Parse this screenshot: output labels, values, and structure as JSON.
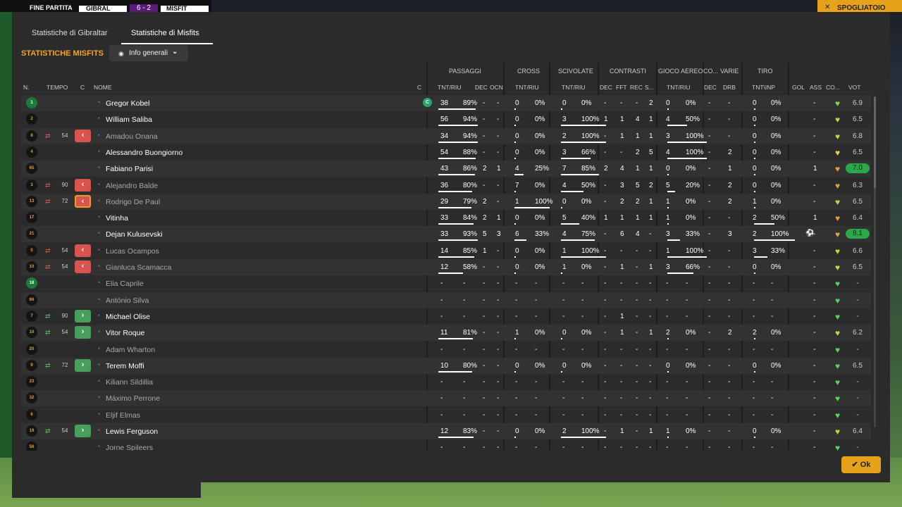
{
  "topbar": {
    "fine_partita": "FINE PARTITA",
    "team1": "GIBRAL",
    "score": "6 - 2",
    "team2": "MISFIT",
    "right_label": "SPOGLIATOIO",
    "close": "✕"
  },
  "tabs": [
    {
      "label": "Statistiche di Gibraltar"
    },
    {
      "label": "Statistiche di Misfits"
    }
  ],
  "section_title": "STATISTICHE MISFITS",
  "dropdown": {
    "label": "Info generali"
  },
  "groups": [
    {
      "label": "PASSAGGI"
    },
    {
      "label": "CROSS"
    },
    {
      "label": "SCIVOLATE"
    },
    {
      "label": "CONTRASTI"
    },
    {
      "label": "GIOCO AEREO"
    },
    {
      "label": "CO..."
    },
    {
      "label": "VARIE"
    },
    {
      "label": "TIRO"
    }
  ],
  "columns": {
    "n": "N.",
    "tempo": "TEMPO",
    "c": "C",
    "nome": "NOME",
    "c2": "C",
    "pass_tnt": "TNT/RIU",
    "pass_dec": "DEC",
    "pass_ocn": "OCN",
    "cross_tnt": "TNT/RIU",
    "sciv_tnt": "TNT/RIU",
    "con_dec": "DEC",
    "con_fft": "FFT",
    "con_rec": "REC",
    "con_s": "S...",
    "aereo_tnt": "TNT/RIU",
    "co_dec": "DEC",
    "varie_drb": "DRB",
    "tiro_tnt": "TNT\\INP",
    "gol": "GOL",
    "ass": "ASS",
    "co": "CO...",
    "vot": "VOT"
  },
  "players": [
    {
      "num": "1",
      "gk": true,
      "name": "Gregor Kobel",
      "dim": false,
      "captain": "C",
      "p_t": "38",
      "p_p": "89%",
      "p_dec": "-",
      "p_ocn": "-",
      "cr_t": "0",
      "cr_p": "0%",
      "sc_t": "0",
      "sc_p": "0%",
      "c1": "-",
      "c2": "-",
      "c3": "-",
      "c4": "2",
      "a_t": "0",
      "a_p": "0%",
      "co": "-",
      "drb": "-",
      "t_t": "0",
      "t_p": "0%",
      "gol": "",
      "ass": "-",
      "vote": "6.9",
      "heart": "#7ed957"
    },
    {
      "num": "2",
      "name": "William Saliba",
      "dim": false,
      "p_t": "56",
      "p_p": "94%",
      "p_dec": "-",
      "p_ocn": "-",
      "cr_t": "0",
      "cr_p": "0%",
      "sc_t": "3",
      "sc_p": "100%",
      "c1": "1",
      "c2": "1",
      "c3": "4",
      "c4": "1",
      "a_t": "4",
      "a_p": "50%",
      "co": "-",
      "drb": "-",
      "t_t": "0",
      "t_p": "0%",
      "gol": "",
      "ass": "-",
      "vote": "6.5",
      "heart": "#b8d94a"
    },
    {
      "num": "8",
      "name": "Amadou Onana",
      "dim": true,
      "sub": "out",
      "min": "54",
      "p_t": "34",
      "p_p": "94%",
      "p_dec": "-",
      "p_ocn": "-",
      "cr_t": "0",
      "cr_p": "0%",
      "sc_t": "2",
      "sc_p": "100%",
      "c1": "-",
      "c2": "1",
      "c3": "1",
      "c4": "1",
      "a_t": "3",
      "a_p": "100%",
      "co": "-",
      "drb": "-",
      "t_t": "0",
      "t_p": "0%",
      "gol": "",
      "ass": "-",
      "vote": "6.8",
      "heart": "#b8d94a"
    },
    {
      "num": "4",
      "name": "Alessandro Buongiorno",
      "dim": false,
      "p_t": "54",
      "p_p": "88%",
      "p_dec": "-",
      "p_ocn": "-",
      "cr_t": "0",
      "cr_p": "0%",
      "sc_t": "3",
      "sc_p": "66%",
      "c1": "-",
      "c2": "-",
      "c3": "2",
      "c4": "5",
      "a_t": "4",
      "a_p": "100%",
      "co": "-",
      "drb": "2",
      "t_t": "0",
      "t_p": "0%",
      "gol": "",
      "ass": "-",
      "vote": "6.5",
      "heart": "#e3d24a"
    },
    {
      "num": "65",
      "name": "Fabiano Parisi",
      "dim": false,
      "p_t": "43",
      "p_p": "86%",
      "p_dec": "2",
      "p_ocn": "1",
      "cr_t": "4",
      "cr_p": "25%",
      "sc_t": "7",
      "sc_p": "85%",
      "c1": "2",
      "c2": "4",
      "c3": "1",
      "c4": "1",
      "a_t": "0",
      "a_p": "0%",
      "co": "-",
      "drb": "1",
      "t_t": "0",
      "t_p": "0%",
      "gol": "",
      "ass": "1",
      "vote": "7.0",
      "vhi": true,
      "heart": "#e0a04a"
    },
    {
      "num": "3",
      "name": "Alejandro Balde",
      "dim": true,
      "sub": "out",
      "min": "90",
      "p_t": "36",
      "p_p": "80%",
      "p_dec": "-",
      "p_ocn": "-",
      "cr_t": "7",
      "cr_p": "0%",
      "sc_t": "4",
      "sc_p": "50%",
      "c1": "-",
      "c2": "3",
      "c3": "5",
      "c4": "2",
      "a_t": "5",
      "a_p": "20%",
      "co": "-",
      "drb": "2",
      "t_t": "0",
      "t_p": "0%",
      "gol": "",
      "ass": "-",
      "vote": "6.3",
      "heart": "#e0a04a"
    },
    {
      "num": "13",
      "name": "Rodrigo De Paul",
      "dim": true,
      "sub": "out",
      "yellow": true,
      "min": "72",
      "p_t": "29",
      "p_p": "79%",
      "p_dec": "2",
      "p_ocn": "-",
      "cr_t": "1",
      "cr_p": "100%",
      "sc_t": "0",
      "sc_p": "0%",
      "c1": "-",
      "c2": "2",
      "c3": "2",
      "c4": "1",
      "a_t": "1",
      "a_p": "0%",
      "co": "-",
      "drb": "2",
      "t_t": "1",
      "t_p": "0%",
      "gol": "",
      "ass": "-",
      "vote": "6.5",
      "heart": "#b8d94a"
    },
    {
      "num": "17",
      "name": "Vitinha",
      "dim": false,
      "p_t": "33",
      "p_p": "84%",
      "p_dec": "2",
      "p_ocn": "1",
      "cr_t": "0",
      "cr_p": "0%",
      "sc_t": "5",
      "sc_p": "40%",
      "c1": "1",
      "c2": "1",
      "c3": "1",
      "c4": "1",
      "a_t": "1",
      "a_p": "0%",
      "co": "-",
      "drb": "-",
      "t_t": "2",
      "t_p": "50%",
      "gol": "",
      "ass": "1",
      "vote": "6.4",
      "heart": "#e0a04a"
    },
    {
      "num": "21",
      "name": "Dejan Kulusevski",
      "dim": false,
      "p_t": "33",
      "p_p": "93%",
      "p_dec": "5",
      "p_ocn": "3",
      "cr_t": "6",
      "cr_p": "33%",
      "sc_t": "4",
      "sc_p": "75%",
      "c1": "-",
      "c2": "6",
      "c3": "4",
      "c4": "-",
      "a_t": "3",
      "a_p": "33%",
      "co": "-",
      "drb": "3",
      "t_t": "2",
      "t_p": "100%",
      "gol": "⚽",
      "ass": "-",
      "vote": "8.1",
      "vhi": true,
      "heart": "#e0a04a"
    },
    {
      "num": "5",
      "name": "Lucas Ocampos",
      "dim": true,
      "sub": "out",
      "min": "54",
      "p_t": "14",
      "p_p": "85%",
      "p_dec": "1",
      "p_ocn": "-",
      "cr_t": "0",
      "cr_p": "0%",
      "sc_t": "1",
      "sc_p": "100%",
      "c1": "-",
      "c2": "-",
      "c3": "-",
      "c4": "-",
      "a_t": "1",
      "a_p": "100%",
      "co": "-",
      "drb": "-",
      "t_t": "3",
      "t_p": "33%",
      "gol": "",
      "ass": "-",
      "vote": "6.6",
      "heart": "#b8d94a"
    },
    {
      "num": "10",
      "name": "Gianluca Scamacca",
      "dim": true,
      "sub": "out",
      "min": "54",
      "p_t": "12",
      "p_p": "58%",
      "p_dec": "-",
      "p_ocn": "-",
      "cr_t": "0",
      "cr_p": "0%",
      "sc_t": "1",
      "sc_p": "0%",
      "c1": "-",
      "c2": "1",
      "c3": "-",
      "c4": "1",
      "a_t": "3",
      "a_p": "66%",
      "co": "-",
      "drb": "-",
      "t_t": "0",
      "t_p": "0%",
      "gol": "",
      "ass": "-",
      "vote": "6.5",
      "heart": "#b8d94a"
    },
    {
      "num": "18",
      "gk": true,
      "name": "Elia Caprile",
      "dim": true,
      "p_t": "-",
      "p_p": "-",
      "p_dec": "-",
      "p_ocn": "-",
      "cr_t": "-",
      "cr_p": "-",
      "sc_t": "-",
      "sc_p": "-",
      "c1": "-",
      "c2": "-",
      "c3": "-",
      "c4": "-",
      "a_t": "-",
      "a_p": "-",
      "co": "-",
      "drb": "-",
      "t_t": "-",
      "t_p": "-",
      "gol": "",
      "ass": "-",
      "vote": "-",
      "heart": "#5cd15c"
    },
    {
      "num": "66",
      "name": "António Silva",
      "dim": true,
      "p_t": "-",
      "p_p": "-",
      "p_dec": "-",
      "p_ocn": "-",
      "cr_t": "-",
      "cr_p": "-",
      "sc_t": "-",
      "sc_p": "-",
      "c1": "-",
      "c2": "-",
      "c3": "-",
      "c4": "-",
      "a_t": "-",
      "a_p": "-",
      "co": "-",
      "drb": "-",
      "t_t": "-",
      "t_p": "-",
      "gol": "",
      "ass": "-",
      "vote": "-",
      "heart": "#5cd15c"
    },
    {
      "num": "7",
      "name": "Michael Olise",
      "dim": false,
      "sub": "in",
      "min": "90",
      "p_t": "-",
      "p_p": "-",
      "p_dec": "-",
      "p_ocn": "-",
      "cr_t": "-",
      "cr_p": "-",
      "sc_t": "-",
      "sc_p": "-",
      "c1": "-",
      "c2": "1",
      "c3": "-",
      "c4": "-",
      "a_t": "-",
      "a_p": "-",
      "co": "-",
      "drb": "-",
      "t_t": "-",
      "t_p": "-",
      "gol": "",
      "ass": "-",
      "vote": "-",
      "heart": "#5cd15c"
    },
    {
      "num": "10",
      "name": "Vitor Roque",
      "dim": false,
      "sub": "in",
      "min": "54",
      "p_t": "11",
      "p_p": "81%",
      "p_dec": "-",
      "p_ocn": "-",
      "cr_t": "1",
      "cr_p": "0%",
      "sc_t": "0",
      "sc_p": "0%",
      "c1": "-",
      "c2": "1",
      "c3": "-",
      "c4": "1",
      "a_t": "2",
      "a_p": "0%",
      "co": "-",
      "drb": "2",
      "t_t": "2",
      "t_p": "0%",
      "gol": "",
      "ass": "-",
      "vote": "6.2",
      "heart": "#b8d94a"
    },
    {
      "num": "20",
      "name": "Adam Wharton",
      "dim": true,
      "p_t": "-",
      "p_p": "-",
      "p_dec": "-",
      "p_ocn": "-",
      "cr_t": "-",
      "cr_p": "-",
      "sc_t": "-",
      "sc_p": "-",
      "c1": "-",
      "c2": "-",
      "c3": "-",
      "c4": "-",
      "a_t": "-",
      "a_p": "-",
      "co": "-",
      "drb": "-",
      "t_t": "-",
      "t_p": "-",
      "gol": "",
      "ass": "-",
      "vote": "-",
      "heart": "#5cd15c"
    },
    {
      "num": "9",
      "name": "Terem Moffi",
      "dim": false,
      "sub": "in",
      "min": "72",
      "p_t": "10",
      "p_p": "80%",
      "p_dec": "-",
      "p_ocn": "-",
      "cr_t": "0",
      "cr_p": "0%",
      "sc_t": "0",
      "sc_p": "0%",
      "c1": "-",
      "c2": "-",
      "c3": "-",
      "c4": "-",
      "a_t": "0",
      "a_p": "0%",
      "co": "-",
      "drb": "-",
      "t_t": "0",
      "t_p": "0%",
      "gol": "",
      "ass": "-",
      "vote": "6.5",
      "heart": "#5cd15c"
    },
    {
      "num": "23",
      "name": "Kiliann Sildillia",
      "dim": true,
      "p_t": "-",
      "p_p": "-",
      "p_dec": "-",
      "p_ocn": "-",
      "cr_t": "-",
      "cr_p": "-",
      "sc_t": "-",
      "sc_p": "-",
      "c1": "-",
      "c2": "-",
      "c3": "-",
      "c4": "-",
      "a_t": "-",
      "a_p": "-",
      "co": "-",
      "drb": "-",
      "t_t": "-",
      "t_p": "-",
      "gol": "",
      "ass": "-",
      "vote": "-",
      "heart": "#5cd15c"
    },
    {
      "num": "32",
      "name": "Máximo Perrone",
      "dim": true,
      "p_t": "-",
      "p_p": "-",
      "p_dec": "-",
      "p_ocn": "-",
      "cr_t": "-",
      "cr_p": "-",
      "sc_t": "-",
      "sc_p": "-",
      "c1": "-",
      "c2": "-",
      "c3": "-",
      "c4": "-",
      "a_t": "-",
      "a_p": "-",
      "co": "-",
      "drb": "-",
      "t_t": "-",
      "t_p": "-",
      "gol": "",
      "ass": "-",
      "vote": "-",
      "heart": "#5cd15c"
    },
    {
      "num": "6",
      "name": "Eljif Elmas",
      "dim": true,
      "p_t": "-",
      "p_p": "-",
      "p_dec": "-",
      "p_ocn": "-",
      "cr_t": "-",
      "cr_p": "-",
      "sc_t": "-",
      "sc_p": "-",
      "c1": "-",
      "c2": "-",
      "c3": "-",
      "c4": "-",
      "a_t": "-",
      "a_p": "-",
      "co": "-",
      "drb": "-",
      "t_t": "-",
      "t_p": "-",
      "gol": "",
      "ass": "-",
      "vote": "-",
      "heart": "#5cd15c"
    },
    {
      "num": "19",
      "name": "Lewis Ferguson",
      "dim": false,
      "sub": "in",
      "min": "54",
      "p_t": "12",
      "p_p": "83%",
      "p_dec": "-",
      "p_ocn": "-",
      "cr_t": "0",
      "cr_p": "0%",
      "sc_t": "2",
      "sc_p": "100%",
      "c1": "-",
      "c2": "1",
      "c3": "-",
      "c4": "1",
      "a_t": "1",
      "a_p": "0%",
      "co": "-",
      "drb": "-",
      "t_t": "0",
      "t_p": "0%",
      "gol": "",
      "ass": "-",
      "vote": "6.4",
      "heart": "#b8d94a"
    },
    {
      "num": "56",
      "name": "Jorne Spileers",
      "dim": true,
      "p_t": "-",
      "p_p": "-",
      "p_dec": "-",
      "p_ocn": "-",
      "cr_t": "-",
      "cr_p": "-",
      "sc_t": "-",
      "sc_p": "-",
      "c1": "-",
      "c2": "-",
      "c3": "-",
      "c4": "-",
      "a_t": "-",
      "a_p": "-",
      "co": "-",
      "drb": "-",
      "t_t": "-",
      "t_p": "-",
      "gol": "",
      "ass": "-",
      "vote": "-",
      "heart": "#5cd15c"
    }
  ],
  "ok_button": {
    "label": "Ok"
  }
}
